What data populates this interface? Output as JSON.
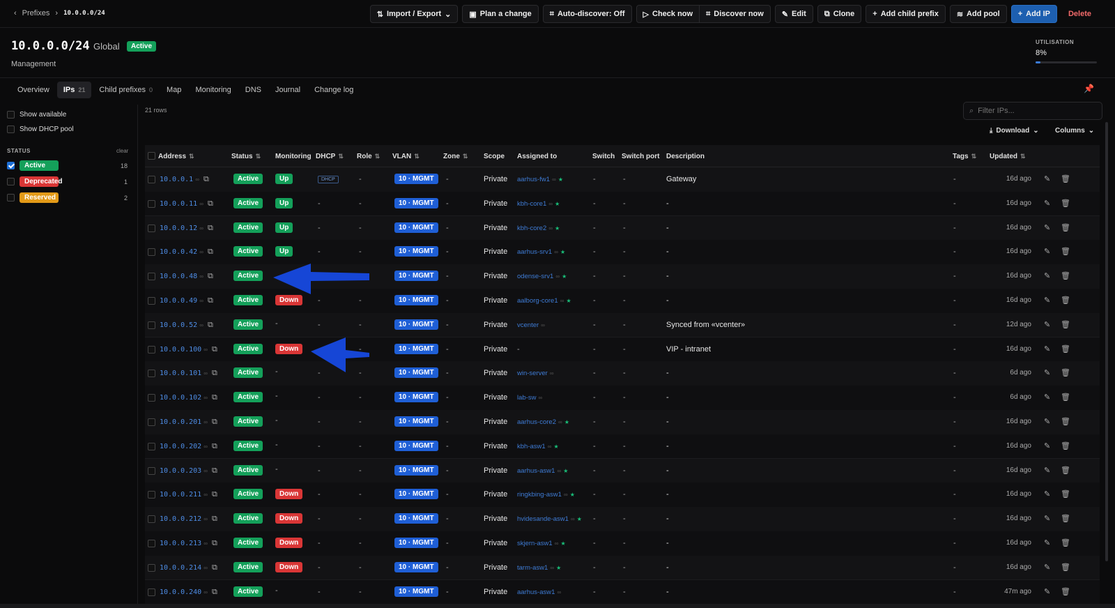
{
  "breadcrumb": {
    "parent": "Prefixes",
    "current": "10.0.0.0/24"
  },
  "toolbar": {
    "import_export": "Import / Export",
    "plan": "Plan a change",
    "autodiscover": "Auto-discover: Off",
    "check_now": "Check now",
    "discover_now": "Discover now",
    "edit": "Edit",
    "clone": "Clone",
    "add_child": "Add child prefix",
    "add_pool": "Add pool",
    "add_ip": "Add IP",
    "delete": "Delete"
  },
  "header": {
    "title": "10.0.0.0/24",
    "scope": "Global",
    "status": "Active",
    "subtitle": "Management",
    "utilisation_label": "UTILISATION",
    "utilisation_value": "8%",
    "utilisation_fraction": 0.08
  },
  "tabs": [
    {
      "label": "Overview",
      "count": ""
    },
    {
      "label": "IPs",
      "count": "21"
    },
    {
      "label": "Child prefixes",
      "count": "0"
    },
    {
      "label": "Map",
      "count": ""
    },
    {
      "label": "Monitoring",
      "count": ""
    },
    {
      "label": "DNS",
      "count": ""
    },
    {
      "label": "Journal",
      "count": ""
    },
    {
      "label": "Change log",
      "count": ""
    }
  ],
  "sidebar": {
    "show_available": "Show available",
    "show_dhcp": "Show DHCP pool",
    "status_heading": "STATUS",
    "clear": "clear",
    "statuses": [
      {
        "label": "Active",
        "count": "18",
        "color": "#14a05a",
        "checked": true
      },
      {
        "label": "Deprecated",
        "count": "1",
        "color": "#d93636",
        "checked": false
      },
      {
        "label": "Reserved",
        "count": "2",
        "color": "#e39a18",
        "checked": false
      }
    ]
  },
  "table_meta": {
    "rows_text": "21 rows",
    "filter_placeholder": "Filter IPs...",
    "download": "Download",
    "columns": "Columns"
  },
  "columns": {
    "address": "Address",
    "status": "Status",
    "monitoring": "Monitoring",
    "dhcp": "DHCP",
    "role": "Role",
    "vlan": "VLAN",
    "zone": "Zone",
    "scope": "Scope",
    "assigned": "Assigned to",
    "switch": "Switch",
    "switch_port": "Switch port",
    "description": "Description",
    "tags": "Tags",
    "updated": "Updated"
  },
  "rows": [
    {
      "address": "10.0.0.1",
      "status": "Active",
      "monitoring": "Up",
      "dhcp": "DHCP",
      "role": "-",
      "vlan": "10 · MGMT",
      "zone": "-",
      "scope": "Private",
      "assigned": "aarhus-fw1",
      "star": true,
      "switch": "-",
      "port": "-",
      "description": "Gateway",
      "tags": "-",
      "updated": "16d ago"
    },
    {
      "address": "10.0.0.11",
      "status": "Active",
      "monitoring": "Up",
      "dhcp": "-",
      "role": "-",
      "vlan": "10 · MGMT",
      "zone": "-",
      "scope": "Private",
      "assigned": "kbh-core1",
      "star": true,
      "switch": "-",
      "port": "-",
      "description": "-",
      "tags": "-",
      "updated": "16d ago"
    },
    {
      "address": "10.0.0.12",
      "status": "Active",
      "monitoring": "Up",
      "dhcp": "-",
      "role": "-",
      "vlan": "10 · MGMT",
      "zone": "-",
      "scope": "Private",
      "assigned": "kbh-core2",
      "star": true,
      "switch": "-",
      "port": "-",
      "description": "-",
      "tags": "-",
      "updated": "16d ago"
    },
    {
      "address": "10.0.0.42",
      "status": "Active",
      "monitoring": "Up",
      "dhcp": "-",
      "role": "-",
      "vlan": "10 · MGMT",
      "zone": "-",
      "scope": "Private",
      "assigned": "aarhus-srv1",
      "star": true,
      "switch": "-",
      "port": "-",
      "description": "-",
      "tags": "-",
      "updated": "16d ago"
    },
    {
      "address": "10.0.0.48",
      "status": "Active",
      "monitoring": "",
      "dhcp": "-",
      "role": "-",
      "vlan": "10 · MGMT",
      "zone": "-",
      "scope": "Private",
      "assigned": "odense-srv1",
      "star": true,
      "switch": "-",
      "port": "-",
      "description": "-",
      "tags": "-",
      "updated": "16d ago"
    },
    {
      "address": "10.0.0.49",
      "status": "Active",
      "monitoring": "Down",
      "dhcp": "-",
      "role": "-",
      "vlan": "10 · MGMT",
      "zone": "-",
      "scope": "Private",
      "assigned": "aalborg-core1",
      "star": true,
      "switch": "-",
      "port": "-",
      "description": "-",
      "tags": "-",
      "updated": "16d ago"
    },
    {
      "address": "10.0.0.52",
      "status": "Active",
      "monitoring": "-",
      "dhcp": "-",
      "role": "-",
      "vlan": "10 · MGMT",
      "zone": "-",
      "scope": "Private",
      "assigned": "vcenter",
      "star": false,
      "switch": "-",
      "port": "-",
      "description": "Synced from «vcenter»",
      "tags": "-",
      "updated": "12d ago"
    },
    {
      "address": "10.0.0.100",
      "status": "Active",
      "monitoring": "Down",
      "dhcp": "-",
      "role": "-",
      "vlan": "10 · MGMT",
      "zone": "-",
      "scope": "Private",
      "assigned": "-",
      "star": false,
      "switch": "-",
      "port": "-",
      "description": "VIP - intranet",
      "tags": "-",
      "updated": "16d ago"
    },
    {
      "address": "10.0.0.101",
      "status": "Active",
      "monitoring": "-",
      "dhcp": "-",
      "role": "-",
      "vlan": "10 · MGMT",
      "zone": "-",
      "scope": "Private",
      "assigned": "win-server",
      "star": false,
      "switch": "-",
      "port": "-",
      "description": "-",
      "tags": "-",
      "updated": "6d ago"
    },
    {
      "address": "10.0.0.102",
      "status": "Active",
      "monitoring": "-",
      "dhcp": "-",
      "role": "-",
      "vlan": "10 · MGMT",
      "zone": "-",
      "scope": "Private",
      "assigned": "lab-sw",
      "star": false,
      "switch": "-",
      "port": "-",
      "description": "-",
      "tags": "-",
      "updated": "6d ago"
    },
    {
      "address": "10.0.0.201",
      "status": "Active",
      "monitoring": "-",
      "dhcp": "-",
      "role": "-",
      "vlan": "10 · MGMT",
      "zone": "-",
      "scope": "Private",
      "assigned": "aarhus-core2",
      "star": true,
      "switch": "-",
      "port": "-",
      "description": "-",
      "tags": "-",
      "updated": "16d ago"
    },
    {
      "address": "10.0.0.202",
      "status": "Active",
      "monitoring": "-",
      "dhcp": "-",
      "role": "-",
      "vlan": "10 · MGMT",
      "zone": "-",
      "scope": "Private",
      "assigned": "kbh-asw1",
      "star": true,
      "switch": "-",
      "port": "-",
      "description": "-",
      "tags": "-",
      "updated": "16d ago"
    },
    {
      "address": "10.0.0.203",
      "status": "Active",
      "monitoring": "-",
      "dhcp": "-",
      "role": "-",
      "vlan": "10 · MGMT",
      "zone": "-",
      "scope": "Private",
      "assigned": "aarhus-asw1",
      "star": true,
      "switch": "-",
      "port": "-",
      "description": "-",
      "tags": "-",
      "updated": "16d ago"
    },
    {
      "address": "10.0.0.211",
      "status": "Active",
      "monitoring": "Down",
      "dhcp": "-",
      "role": "-",
      "vlan": "10 · MGMT",
      "zone": "-",
      "scope": "Private",
      "assigned": "ringkbing-asw1",
      "star": true,
      "switch": "-",
      "port": "-",
      "description": "-",
      "tags": "-",
      "updated": "16d ago"
    },
    {
      "address": "10.0.0.212",
      "status": "Active",
      "monitoring": "Down",
      "dhcp": "-",
      "role": "-",
      "vlan": "10 · MGMT",
      "zone": "-",
      "scope": "Private",
      "assigned": "hvidesande-asw1",
      "star": true,
      "switch": "-",
      "port": "-",
      "description": "-",
      "tags": "-",
      "updated": "16d ago"
    },
    {
      "address": "10.0.0.213",
      "status": "Active",
      "monitoring": "Down",
      "dhcp": "-",
      "role": "-",
      "vlan": "10 · MGMT",
      "zone": "-",
      "scope": "Private",
      "assigned": "skjern-asw1",
      "star": true,
      "switch": "-",
      "port": "-",
      "description": "-",
      "tags": "-",
      "updated": "16d ago"
    },
    {
      "address": "10.0.0.214",
      "status": "Active",
      "monitoring": "Down",
      "dhcp": "-",
      "role": "-",
      "vlan": "10 · MGMT",
      "zone": "-",
      "scope": "Private",
      "assigned": "tarm-asw1",
      "star": true,
      "switch": "-",
      "port": "-",
      "description": "-",
      "tags": "-",
      "updated": "16d ago"
    },
    {
      "address": "10.0.0.240",
      "status": "Active",
      "monitoring": "-",
      "dhcp": "-",
      "role": "-",
      "vlan": "10 · MGMT",
      "zone": "-",
      "scope": "Private",
      "assigned": "aarhus-asw1",
      "star": false,
      "switch": "-",
      "port": "-",
      "description": "-",
      "tags": "-",
      "updated": "47m ago"
    }
  ],
  "colors": {
    "active": "#14a05a",
    "down": "#d93636",
    "up": "#14a05a",
    "vlan": "#1f5fd6",
    "link": "#4e8de6",
    "accent": "#1d5fb0"
  }
}
